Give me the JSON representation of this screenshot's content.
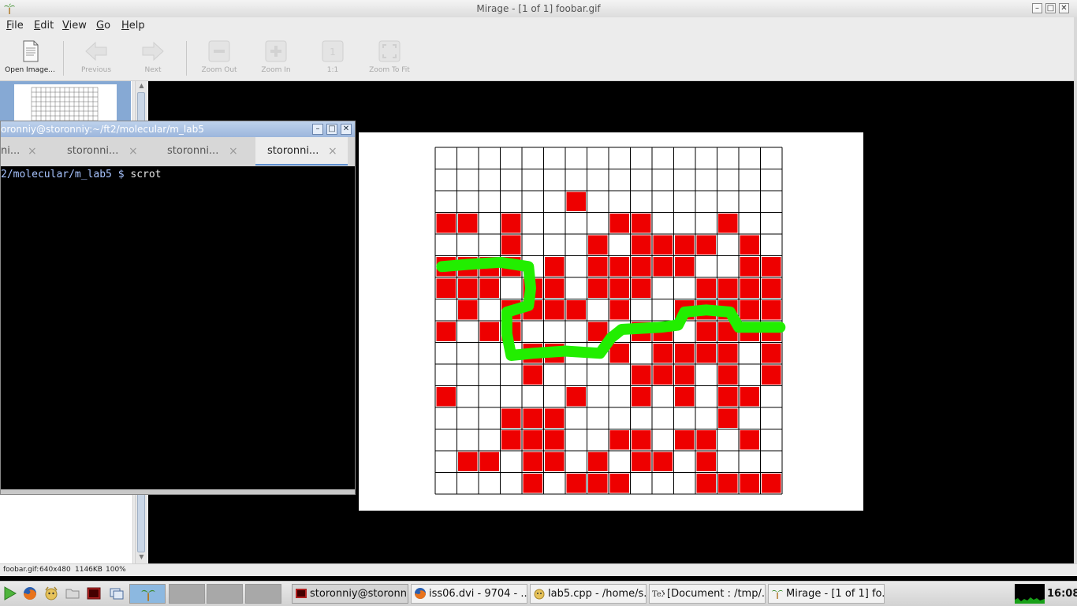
{
  "window": {
    "title": "Mirage - [1 of 1] foobar.gif",
    "controls": {
      "minimize": "–",
      "maximize": "□",
      "close": "✕"
    }
  },
  "menu": [
    "File",
    "Edit",
    "View",
    "Go",
    "Help"
  ],
  "toolbar": {
    "open": "Open Image...",
    "previous": "Previous",
    "next": "Next",
    "zoom_out": "Zoom Out",
    "zoom_in": "Zoom In",
    "one_to_one": "1:1",
    "zoom_fit": "Zoom To Fit"
  },
  "statusbar": {
    "filename": "foobar.gif:",
    "dimensions": "640x480",
    "filesize": "1146KB",
    "zoom": "100%"
  },
  "terminal": {
    "title": "oronniy@storonniy:~/ft2/molecular/m_lab5",
    "tabs": [
      "ni...",
      "storonni...",
      "storonni...",
      "storonni..."
    ],
    "active_tab": 3,
    "prompt": "2/molecular/m_lab5 $ ",
    "command": "scrot"
  },
  "image": {
    "grid_size": 16,
    "fill_color": "#ee0000",
    "path_color": "#22ee00",
    "filled": [
      [
        2,
        6
      ],
      [
        3,
        0
      ],
      [
        3,
        1
      ],
      [
        3,
        3
      ],
      [
        3,
        8
      ],
      [
        3,
        9
      ],
      [
        3,
        13
      ],
      [
        4,
        3
      ],
      [
        4,
        7
      ],
      [
        4,
        9
      ],
      [
        4,
        10
      ],
      [
        4,
        11
      ],
      [
        4,
        12
      ],
      [
        4,
        14
      ],
      [
        5,
        0
      ],
      [
        5,
        1
      ],
      [
        5,
        2
      ],
      [
        5,
        3
      ],
      [
        5,
        5
      ],
      [
        5,
        7
      ],
      [
        5,
        8
      ],
      [
        5,
        9
      ],
      [
        5,
        10
      ],
      [
        5,
        11
      ],
      [
        5,
        14
      ],
      [
        5,
        15
      ],
      [
        6,
        0
      ],
      [
        6,
        1
      ],
      [
        6,
        2
      ],
      [
        6,
        4
      ],
      [
        6,
        5
      ],
      [
        6,
        7
      ],
      [
        6,
        8
      ],
      [
        6,
        9
      ],
      [
        6,
        12
      ],
      [
        6,
        13
      ],
      [
        6,
        14
      ],
      [
        6,
        15
      ],
      [
        7,
        1
      ],
      [
        7,
        3
      ],
      [
        7,
        4
      ],
      [
        7,
        5
      ],
      [
        7,
        6
      ],
      [
        7,
        8
      ],
      [
        7,
        11
      ],
      [
        7,
        12
      ],
      [
        7,
        13
      ],
      [
        7,
        14
      ],
      [
        7,
        15
      ],
      [
        8,
        0
      ],
      [
        8,
        2
      ],
      [
        8,
        3
      ],
      [
        8,
        7
      ],
      [
        8,
        9
      ],
      [
        8,
        10
      ],
      [
        8,
        12
      ],
      [
        8,
        13
      ],
      [
        8,
        14
      ],
      [
        8,
        15
      ],
      [
        9,
        4
      ],
      [
        9,
        5
      ],
      [
        9,
        8
      ],
      [
        9,
        10
      ],
      [
        9,
        11
      ],
      [
        9,
        12
      ],
      [
        9,
        13
      ],
      [
        9,
        15
      ],
      [
        10,
        4
      ],
      [
        10,
        9
      ],
      [
        10,
        10
      ],
      [
        10,
        11
      ],
      [
        10,
        13
      ],
      [
        10,
        15
      ],
      [
        11,
        0
      ],
      [
        11,
        6
      ],
      [
        11,
        9
      ],
      [
        11,
        11
      ],
      [
        11,
        13
      ],
      [
        11,
        14
      ],
      [
        12,
        3
      ],
      [
        12,
        4
      ],
      [
        12,
        5
      ],
      [
        12,
        13
      ],
      [
        13,
        3
      ],
      [
        13,
        4
      ],
      [
        13,
        5
      ],
      [
        13,
        8
      ],
      [
        13,
        9
      ],
      [
        13,
        11
      ],
      [
        13,
        12
      ],
      [
        13,
        14
      ],
      [
        14,
        1
      ],
      [
        14,
        2
      ],
      [
        14,
        4
      ],
      [
        14,
        5
      ],
      [
        14,
        7
      ],
      [
        14,
        9
      ],
      [
        14,
        10
      ],
      [
        14,
        12
      ],
      [
        15,
        4
      ],
      [
        15,
        6
      ],
      [
        15,
        7
      ],
      [
        15,
        8
      ],
      [
        15,
        12
      ],
      [
        15,
        13
      ],
      [
        15,
        14
      ],
      [
        15,
        15
      ]
    ],
    "path": [
      [
        0.3,
        5.5
      ],
      [
        1.5,
        5.4
      ],
      [
        3,
        5.3
      ],
      [
        4.3,
        5.5
      ],
      [
        4.4,
        6.5
      ],
      [
        4.3,
        7.3
      ],
      [
        3.3,
        7.6
      ],
      [
        3.3,
        8.6
      ],
      [
        3.5,
        9.6
      ],
      [
        4.5,
        9.5
      ],
      [
        6,
        9.4
      ],
      [
        7.6,
        9.5
      ],
      [
        8.1,
        8.8
      ],
      [
        8.6,
        8.4
      ],
      [
        10.4,
        8.3
      ],
      [
        11.2,
        8.2
      ],
      [
        11.5,
        7.6
      ],
      [
        12.5,
        7.5
      ],
      [
        13.6,
        7.6
      ],
      [
        14,
        8.3
      ],
      [
        15.9,
        8.3
      ]
    ]
  },
  "taskbar": {
    "tasks": [
      {
        "label": "storonniy@storonn...",
        "active": true
      },
      {
        "label": "iss06.dvi - 9704 - ...",
        "active": false
      },
      {
        "label": "lab5.cpp - /home/s...",
        "active": false
      },
      {
        "label": "[Document : /tmp/...",
        "active": false
      },
      {
        "label": "Mirage - [1 of 1] fo...",
        "active": false
      }
    ],
    "clock": "16:08"
  }
}
